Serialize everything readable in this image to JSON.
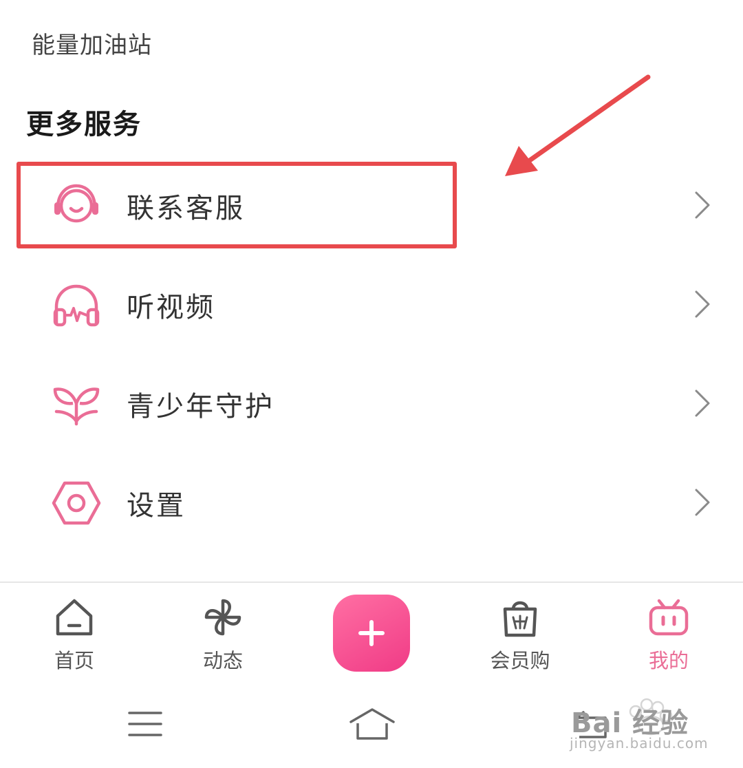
{
  "energy": {
    "label": "能量加油站"
  },
  "section": {
    "title": "更多服务"
  },
  "menu": [
    {
      "label": "联系客服",
      "icon": "customer-service-icon"
    },
    {
      "label": "听视频",
      "icon": "headphones-icon"
    },
    {
      "label": "青少年守护",
      "icon": "sprout-icon"
    },
    {
      "label": "设置",
      "icon": "settings-hexagon-icon"
    }
  ],
  "tabs": [
    {
      "label": "首页",
      "icon": "home-icon"
    },
    {
      "label": "动态",
      "icon": "pinwheel-icon"
    },
    {
      "label": "会员购",
      "icon": "shopping-bag-icon"
    },
    {
      "label": "我的",
      "icon": "tv-mascot-icon",
      "active": true
    }
  ],
  "fab": {
    "icon": "plus-icon"
  },
  "watermark": {
    "text": "Bai 经验",
    "sub": "jingyan.baidu.com"
  },
  "colors": {
    "accent": "#ea6d96",
    "annotation": "#e84a4d",
    "fab": "#f54f8f"
  }
}
